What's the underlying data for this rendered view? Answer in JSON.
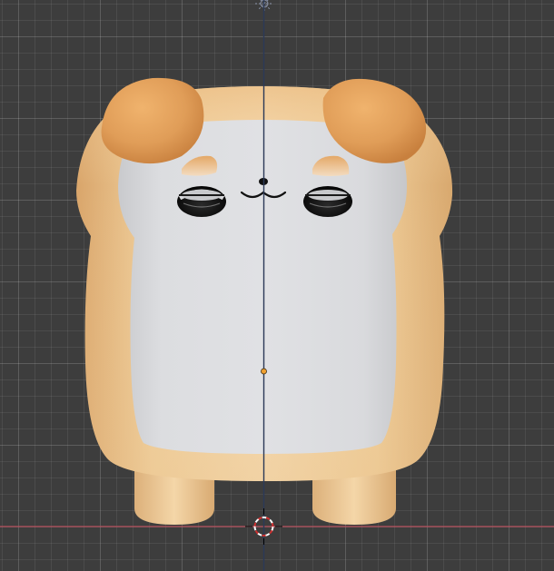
{
  "viewport": {
    "background": "#3d3d3d",
    "grid_color": "#4a4a4a",
    "x_axis_color": "#b04a56",
    "z_axis_color": "#2c3a5a"
  },
  "model": {
    "object": "bread-dog",
    "crust_color": "#f2d4a8",
    "crust_shade": "#d9a86a",
    "face_color": "#d8d9dc",
    "ear_color": "#dd9b57"
  },
  "icons": {
    "cursor": "3d-cursor-icon",
    "origin": "object-origin-icon",
    "light": "light-icon"
  }
}
